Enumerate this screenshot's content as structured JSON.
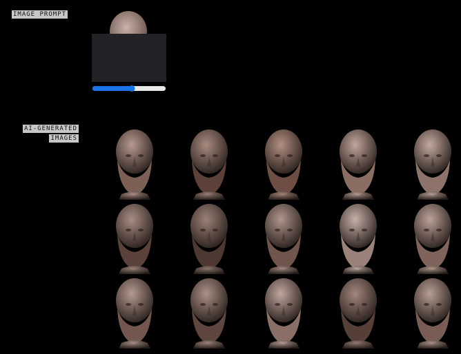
{
  "labels": {
    "image_prompt": "IMAGE PROMPT",
    "ai_generated_line1": "AI-GENERATED",
    "ai_generated_line2": "IMAGES"
  },
  "slider": {
    "value": 0.54
  },
  "colors": {
    "background": "#000000",
    "label_bg": "#c7c7c7",
    "panel": "#232226",
    "slider_accent": "#1a73e8",
    "slider_track": "#e8e8e8"
  },
  "images": {
    "prompt_icon": "bust-head-icon",
    "generated": [
      {
        "tone": "#b89a8f",
        "beard": "#7c5f55"
      },
      {
        "tone": "#a88b80",
        "beard": "#5c4138"
      },
      {
        "tone": "#b38f82",
        "beard": "#6e4e44"
      },
      {
        "tone": "#c2a69b",
        "beard": "#8b6e63"
      },
      {
        "tone": "#c4aaa0",
        "beard": "#8e736a"
      },
      {
        "tone": "#a98e84",
        "beard": "#5a413a"
      },
      {
        "tone": "#9c8278",
        "beard": "#4d3932"
      },
      {
        "tone": "#b0968c",
        "beard": "#6f554c"
      },
      {
        "tone": "#c6b1a8",
        "beard": "#9a827a"
      },
      {
        "tone": "#bda399",
        "beard": "#80645b"
      },
      {
        "tone": "#b59b91",
        "beard": "#73574e"
      },
      {
        "tone": "#ab9186",
        "beard": "#5e453d"
      },
      {
        "tone": "#c0a79d",
        "beard": "#8a6f66"
      },
      {
        "tone": "#a3877d",
        "beard": "#553f37"
      },
      {
        "tone": "#b89f95",
        "beard": "#795d54"
      }
    ]
  }
}
